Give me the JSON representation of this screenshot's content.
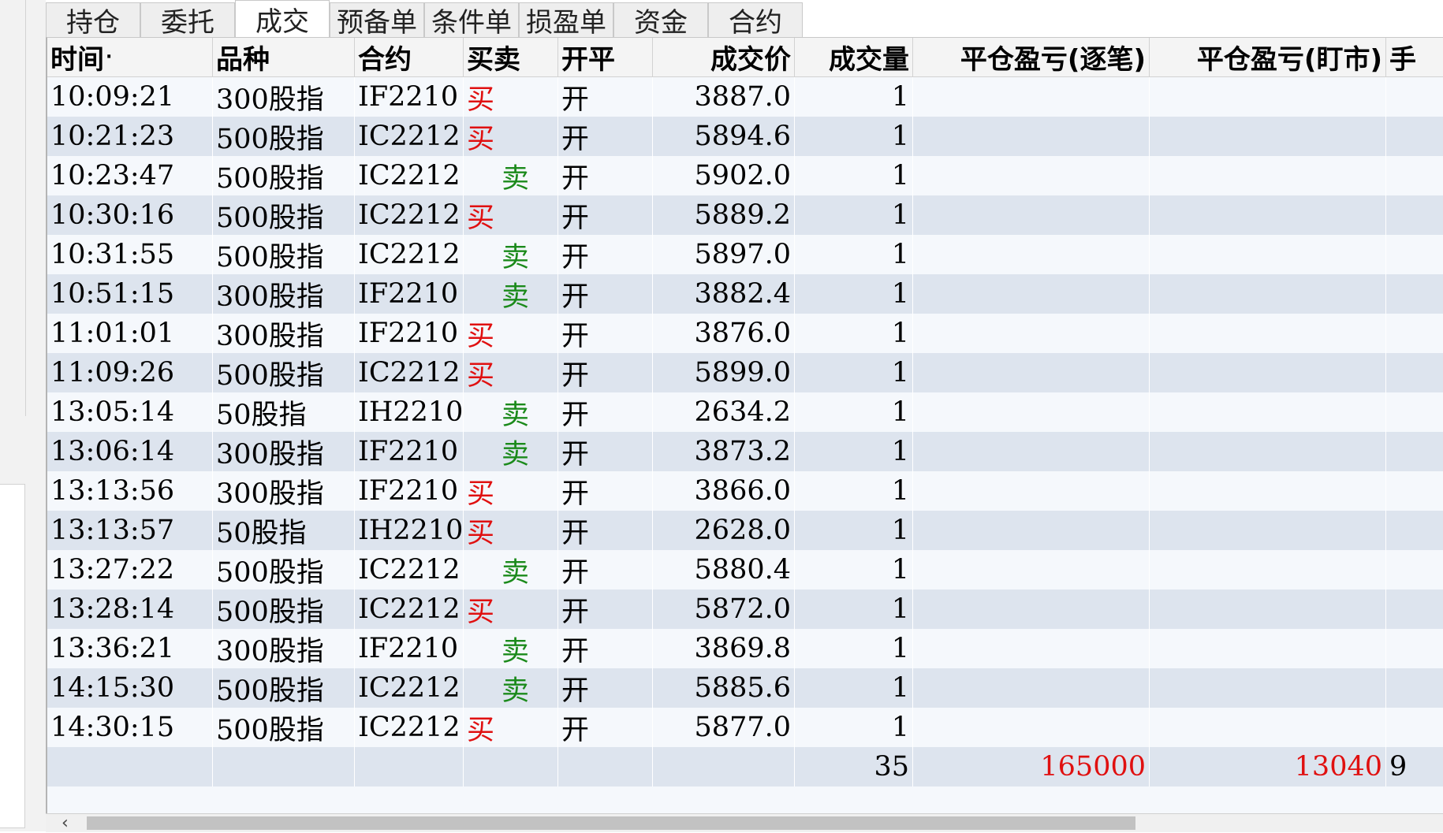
{
  "tabs": [
    "持仓",
    "委托",
    "成交",
    "预备单",
    "条件单",
    "损盈单",
    "资金",
    "合约"
  ],
  "active_tab": "成交",
  "columns": {
    "time": "时间",
    "sort_mark": "·",
    "product": "品种",
    "contract": "合约",
    "side": "买卖",
    "offset": "开平",
    "price": "成交价",
    "volume": "成交量",
    "pnl_trade": "平仓盈亏(逐笔)",
    "pnl_mark": "平仓盈亏(盯市)",
    "more": "手"
  },
  "rows": [
    {
      "time": "10:09:21",
      "product": "300股指",
      "contract": "IF2210",
      "side": "买",
      "offset": "开",
      "price": "3887.0",
      "volume": "1"
    },
    {
      "time": "10:21:23",
      "product": "500股指",
      "contract": "IC2212",
      "side": "买",
      "offset": "开",
      "price": "5894.6",
      "volume": "1"
    },
    {
      "time": "10:23:47",
      "product": "500股指",
      "contract": "IC2212",
      "side": "卖",
      "offset": "开",
      "price": "5902.0",
      "volume": "1"
    },
    {
      "time": "10:30:16",
      "product": "500股指",
      "contract": "IC2212",
      "side": "买",
      "offset": "开",
      "price": "5889.2",
      "volume": "1"
    },
    {
      "time": "10:31:55",
      "product": "500股指",
      "contract": "IC2212",
      "side": "卖",
      "offset": "开",
      "price": "5897.0",
      "volume": "1"
    },
    {
      "time": "10:51:15",
      "product": "300股指",
      "contract": "IF2210",
      "side": "卖",
      "offset": "开",
      "price": "3882.4",
      "volume": "1"
    },
    {
      "time": "11:01:01",
      "product": "300股指",
      "contract": "IF2210",
      "side": "买",
      "offset": "开",
      "price": "3876.0",
      "volume": "1"
    },
    {
      "time": "11:09:26",
      "product": "500股指",
      "contract": "IC2212",
      "side": "买",
      "offset": "开",
      "price": "5899.0",
      "volume": "1"
    },
    {
      "time": "13:05:14",
      "product": "50股指",
      "contract": "IH2210",
      "side": "卖",
      "offset": "开",
      "price": "2634.2",
      "volume": "1"
    },
    {
      "time": "13:06:14",
      "product": "300股指",
      "contract": "IF2210",
      "side": "卖",
      "offset": "开",
      "price": "3873.2",
      "volume": "1"
    },
    {
      "time": "13:13:56",
      "product": "300股指",
      "contract": "IF2210",
      "side": "买",
      "offset": "开",
      "price": "3866.0",
      "volume": "1"
    },
    {
      "time": "13:13:57",
      "product": "50股指",
      "contract": "IH2210",
      "side": "买",
      "offset": "开",
      "price": "2628.0",
      "volume": "1"
    },
    {
      "time": "13:27:22",
      "product": "500股指",
      "contract": "IC2212",
      "side": "卖",
      "offset": "开",
      "price": "5880.4",
      "volume": "1"
    },
    {
      "time": "13:28:14",
      "product": "500股指",
      "contract": "IC2212",
      "side": "买",
      "offset": "开",
      "price": "5872.0",
      "volume": "1"
    },
    {
      "time": "13:36:21",
      "product": "300股指",
      "contract": "IF2210",
      "side": "卖",
      "offset": "开",
      "price": "3869.8",
      "volume": "1"
    },
    {
      "time": "14:15:30",
      "product": "500股指",
      "contract": "IC2212",
      "side": "卖",
      "offset": "开",
      "price": "5885.6",
      "volume": "1"
    },
    {
      "time": "14:30:15",
      "product": "500股指",
      "contract": "IC2212",
      "side": "买",
      "offset": "开",
      "price": "5877.0",
      "volume": "1"
    }
  ],
  "summary": {
    "volume_total": "35",
    "pnl_trade_total": "165000",
    "pnl_mark_total": "13040",
    "more_total": "9"
  },
  "colors": {
    "buy": "#e01010",
    "sell": "#1b8a1b",
    "row_light": "#f5f8fc",
    "row_dark": "#dde4ee"
  }
}
